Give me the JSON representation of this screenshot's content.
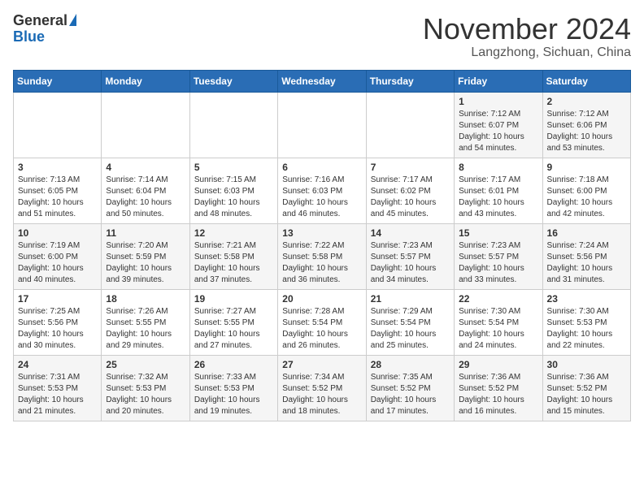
{
  "header": {
    "logo": {
      "general": "General",
      "blue": "Blue"
    },
    "title": "November 2024",
    "location": "Langzhong, Sichuan, China"
  },
  "weekdays": [
    "Sunday",
    "Monday",
    "Tuesday",
    "Wednesday",
    "Thursday",
    "Friday",
    "Saturday"
  ],
  "weeks": [
    [
      null,
      null,
      null,
      null,
      null,
      {
        "day": "1",
        "sunrise": "Sunrise: 7:12 AM",
        "sunset": "Sunset: 6:07 PM",
        "daylight": "Daylight: 10 hours and 54 minutes."
      },
      {
        "day": "2",
        "sunrise": "Sunrise: 7:12 AM",
        "sunset": "Sunset: 6:06 PM",
        "daylight": "Daylight: 10 hours and 53 minutes."
      }
    ],
    [
      {
        "day": "3",
        "sunrise": "Sunrise: 7:13 AM",
        "sunset": "Sunset: 6:05 PM",
        "daylight": "Daylight: 10 hours and 51 minutes."
      },
      {
        "day": "4",
        "sunrise": "Sunrise: 7:14 AM",
        "sunset": "Sunset: 6:04 PM",
        "daylight": "Daylight: 10 hours and 50 minutes."
      },
      {
        "day": "5",
        "sunrise": "Sunrise: 7:15 AM",
        "sunset": "Sunset: 6:03 PM",
        "daylight": "Daylight: 10 hours and 48 minutes."
      },
      {
        "day": "6",
        "sunrise": "Sunrise: 7:16 AM",
        "sunset": "Sunset: 6:03 PM",
        "daylight": "Daylight: 10 hours and 46 minutes."
      },
      {
        "day": "7",
        "sunrise": "Sunrise: 7:17 AM",
        "sunset": "Sunset: 6:02 PM",
        "daylight": "Daylight: 10 hours and 45 minutes."
      },
      {
        "day": "8",
        "sunrise": "Sunrise: 7:17 AM",
        "sunset": "Sunset: 6:01 PM",
        "daylight": "Daylight: 10 hours and 43 minutes."
      },
      {
        "day": "9",
        "sunrise": "Sunrise: 7:18 AM",
        "sunset": "Sunset: 6:00 PM",
        "daylight": "Daylight: 10 hours and 42 minutes."
      }
    ],
    [
      {
        "day": "10",
        "sunrise": "Sunrise: 7:19 AM",
        "sunset": "Sunset: 6:00 PM",
        "daylight": "Daylight: 10 hours and 40 minutes."
      },
      {
        "day": "11",
        "sunrise": "Sunrise: 7:20 AM",
        "sunset": "Sunset: 5:59 PM",
        "daylight": "Daylight: 10 hours and 39 minutes."
      },
      {
        "day": "12",
        "sunrise": "Sunrise: 7:21 AM",
        "sunset": "Sunset: 5:58 PM",
        "daylight": "Daylight: 10 hours and 37 minutes."
      },
      {
        "day": "13",
        "sunrise": "Sunrise: 7:22 AM",
        "sunset": "Sunset: 5:58 PM",
        "daylight": "Daylight: 10 hours and 36 minutes."
      },
      {
        "day": "14",
        "sunrise": "Sunrise: 7:23 AM",
        "sunset": "Sunset: 5:57 PM",
        "daylight": "Daylight: 10 hours and 34 minutes."
      },
      {
        "day": "15",
        "sunrise": "Sunrise: 7:23 AM",
        "sunset": "Sunset: 5:57 PM",
        "daylight": "Daylight: 10 hours and 33 minutes."
      },
      {
        "day": "16",
        "sunrise": "Sunrise: 7:24 AM",
        "sunset": "Sunset: 5:56 PM",
        "daylight": "Daylight: 10 hours and 31 minutes."
      }
    ],
    [
      {
        "day": "17",
        "sunrise": "Sunrise: 7:25 AM",
        "sunset": "Sunset: 5:56 PM",
        "daylight": "Daylight: 10 hours and 30 minutes."
      },
      {
        "day": "18",
        "sunrise": "Sunrise: 7:26 AM",
        "sunset": "Sunset: 5:55 PM",
        "daylight": "Daylight: 10 hours and 29 minutes."
      },
      {
        "day": "19",
        "sunrise": "Sunrise: 7:27 AM",
        "sunset": "Sunset: 5:55 PM",
        "daylight": "Daylight: 10 hours and 27 minutes."
      },
      {
        "day": "20",
        "sunrise": "Sunrise: 7:28 AM",
        "sunset": "Sunset: 5:54 PM",
        "daylight": "Daylight: 10 hours and 26 minutes."
      },
      {
        "day": "21",
        "sunrise": "Sunrise: 7:29 AM",
        "sunset": "Sunset: 5:54 PM",
        "daylight": "Daylight: 10 hours and 25 minutes."
      },
      {
        "day": "22",
        "sunrise": "Sunrise: 7:30 AM",
        "sunset": "Sunset: 5:54 PM",
        "daylight": "Daylight: 10 hours and 24 minutes."
      },
      {
        "day": "23",
        "sunrise": "Sunrise: 7:30 AM",
        "sunset": "Sunset: 5:53 PM",
        "daylight": "Daylight: 10 hours and 22 minutes."
      }
    ],
    [
      {
        "day": "24",
        "sunrise": "Sunrise: 7:31 AM",
        "sunset": "Sunset: 5:53 PM",
        "daylight": "Daylight: 10 hours and 21 minutes."
      },
      {
        "day": "25",
        "sunrise": "Sunrise: 7:32 AM",
        "sunset": "Sunset: 5:53 PM",
        "daylight": "Daylight: 10 hours and 20 minutes."
      },
      {
        "day": "26",
        "sunrise": "Sunrise: 7:33 AM",
        "sunset": "Sunset: 5:53 PM",
        "daylight": "Daylight: 10 hours and 19 minutes."
      },
      {
        "day": "27",
        "sunrise": "Sunrise: 7:34 AM",
        "sunset": "Sunset: 5:52 PM",
        "daylight": "Daylight: 10 hours and 18 minutes."
      },
      {
        "day": "28",
        "sunrise": "Sunrise: 7:35 AM",
        "sunset": "Sunset: 5:52 PM",
        "daylight": "Daylight: 10 hours and 17 minutes."
      },
      {
        "day": "29",
        "sunrise": "Sunrise: 7:36 AM",
        "sunset": "Sunset: 5:52 PM",
        "daylight": "Daylight: 10 hours and 16 minutes."
      },
      {
        "day": "30",
        "sunrise": "Sunrise: 7:36 AM",
        "sunset": "Sunset: 5:52 PM",
        "daylight": "Daylight: 10 hours and 15 minutes."
      }
    ]
  ]
}
